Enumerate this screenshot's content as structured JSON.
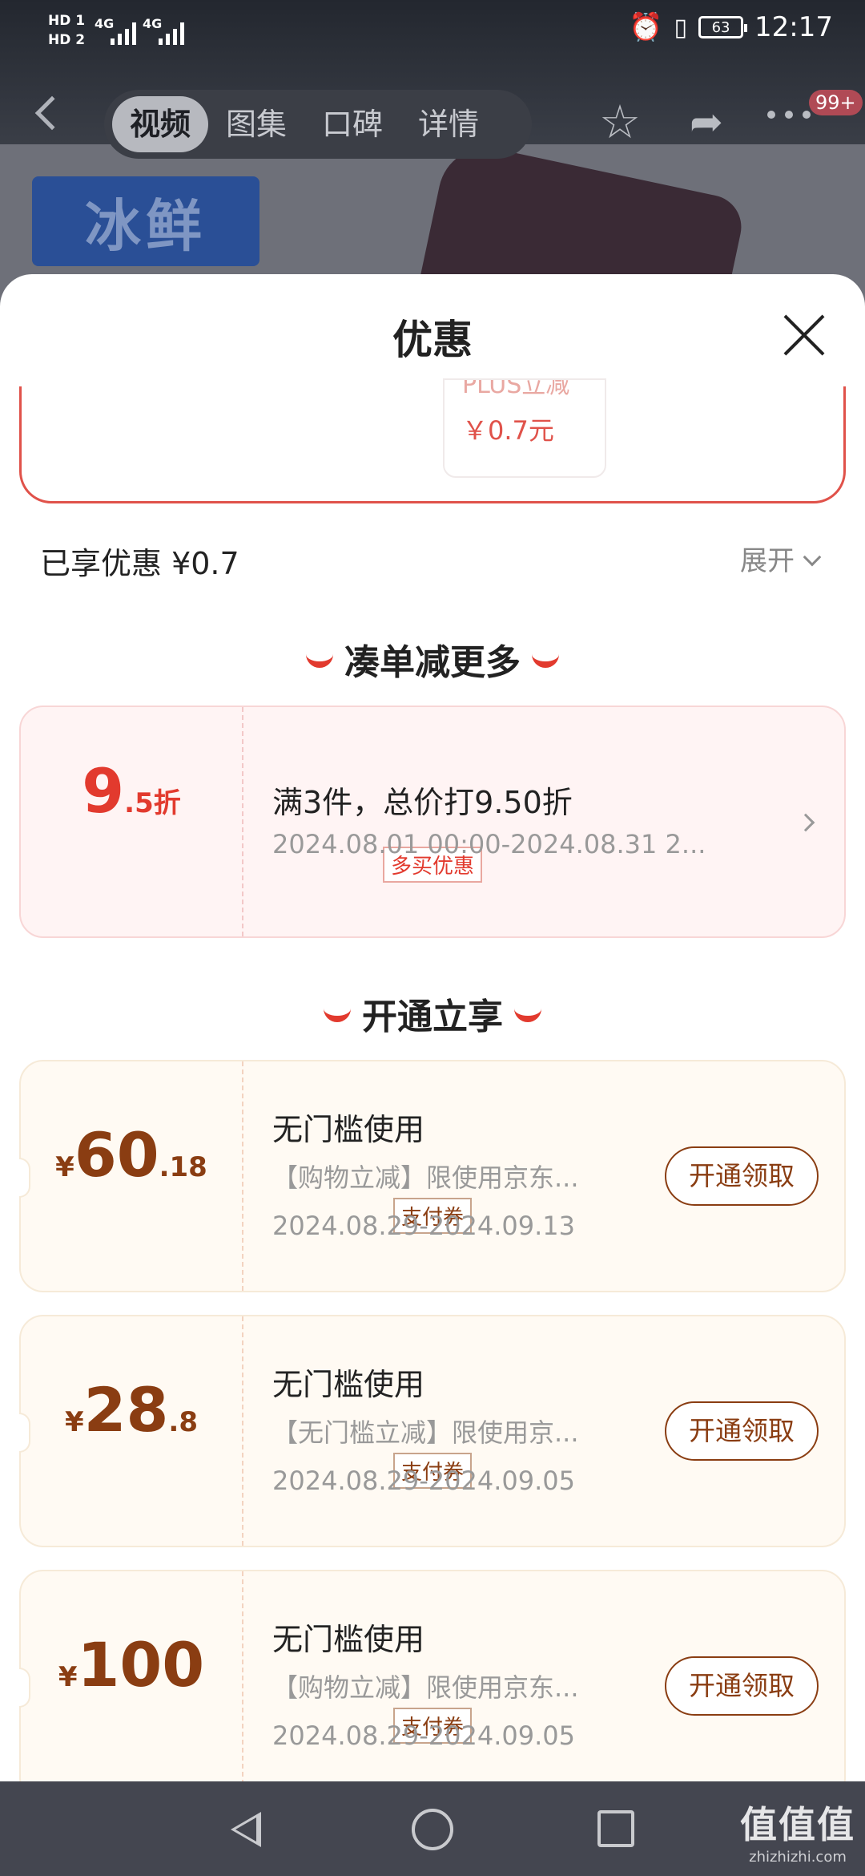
{
  "status_bar": {
    "hd1": "HD 1",
    "hd2": "HD 2",
    "net1": "4G",
    "net2": "4G",
    "battery": "63",
    "time": "12:17"
  },
  "nav": {
    "tabs": [
      {
        "label": "视频",
        "active": true
      },
      {
        "label": "图集",
        "active": false
      },
      {
        "label": "口碑",
        "active": false
      },
      {
        "label": "详情",
        "active": false
      }
    ],
    "badge": "99+",
    "icons": [
      "back-icon",
      "star-icon",
      "share-icon",
      "more-icon"
    ]
  },
  "background": {
    "badge_text": "冰鲜"
  },
  "sheet": {
    "title": "优惠",
    "promo_chip": {
      "line1": "PLUS立减",
      "line2": "￥0.7元"
    },
    "enjoyed": "已享优惠 ¥0.7",
    "expand": "展开"
  },
  "section1": {
    "title": "凑单减更多",
    "discount": {
      "big": "9",
      "small": ".5折",
      "tag": "多买优惠",
      "title": "满3件，总价打9.50折",
      "date": "2024.08.01 00:00-2024.08.31 2..."
    }
  },
  "section2": {
    "title": "开通立享",
    "coupons": [
      {
        "currency": "¥",
        "big": "60",
        "small": ".18",
        "tag": "支付券",
        "title": "无门槛使用",
        "desc": "【购物立减】限使用京东...",
        "date": "2024.08.29-2024.09.13",
        "button": "开通领取"
      },
      {
        "currency": "¥",
        "big": "28",
        "small": ".8",
        "tag": "支付券",
        "title": "无门槛使用",
        "desc": "【无门槛立减】限使用京...",
        "date": "2024.08.29-2024.09.05",
        "button": "开通领取"
      },
      {
        "currency": "¥",
        "big": "100",
        "small": "",
        "tag": "支付券",
        "title": "无门槛使用",
        "desc": "【购物立减】限使用京东...",
        "date": "2024.08.29-2024.09.05",
        "button": "开通领取"
      }
    ]
  },
  "watermark": {
    "line1": "值值值",
    "line2": "zhizhizhi.com"
  },
  "colors": {
    "accent_red": "#e23a2e",
    "coupon_brown": "#8a3d12"
  }
}
